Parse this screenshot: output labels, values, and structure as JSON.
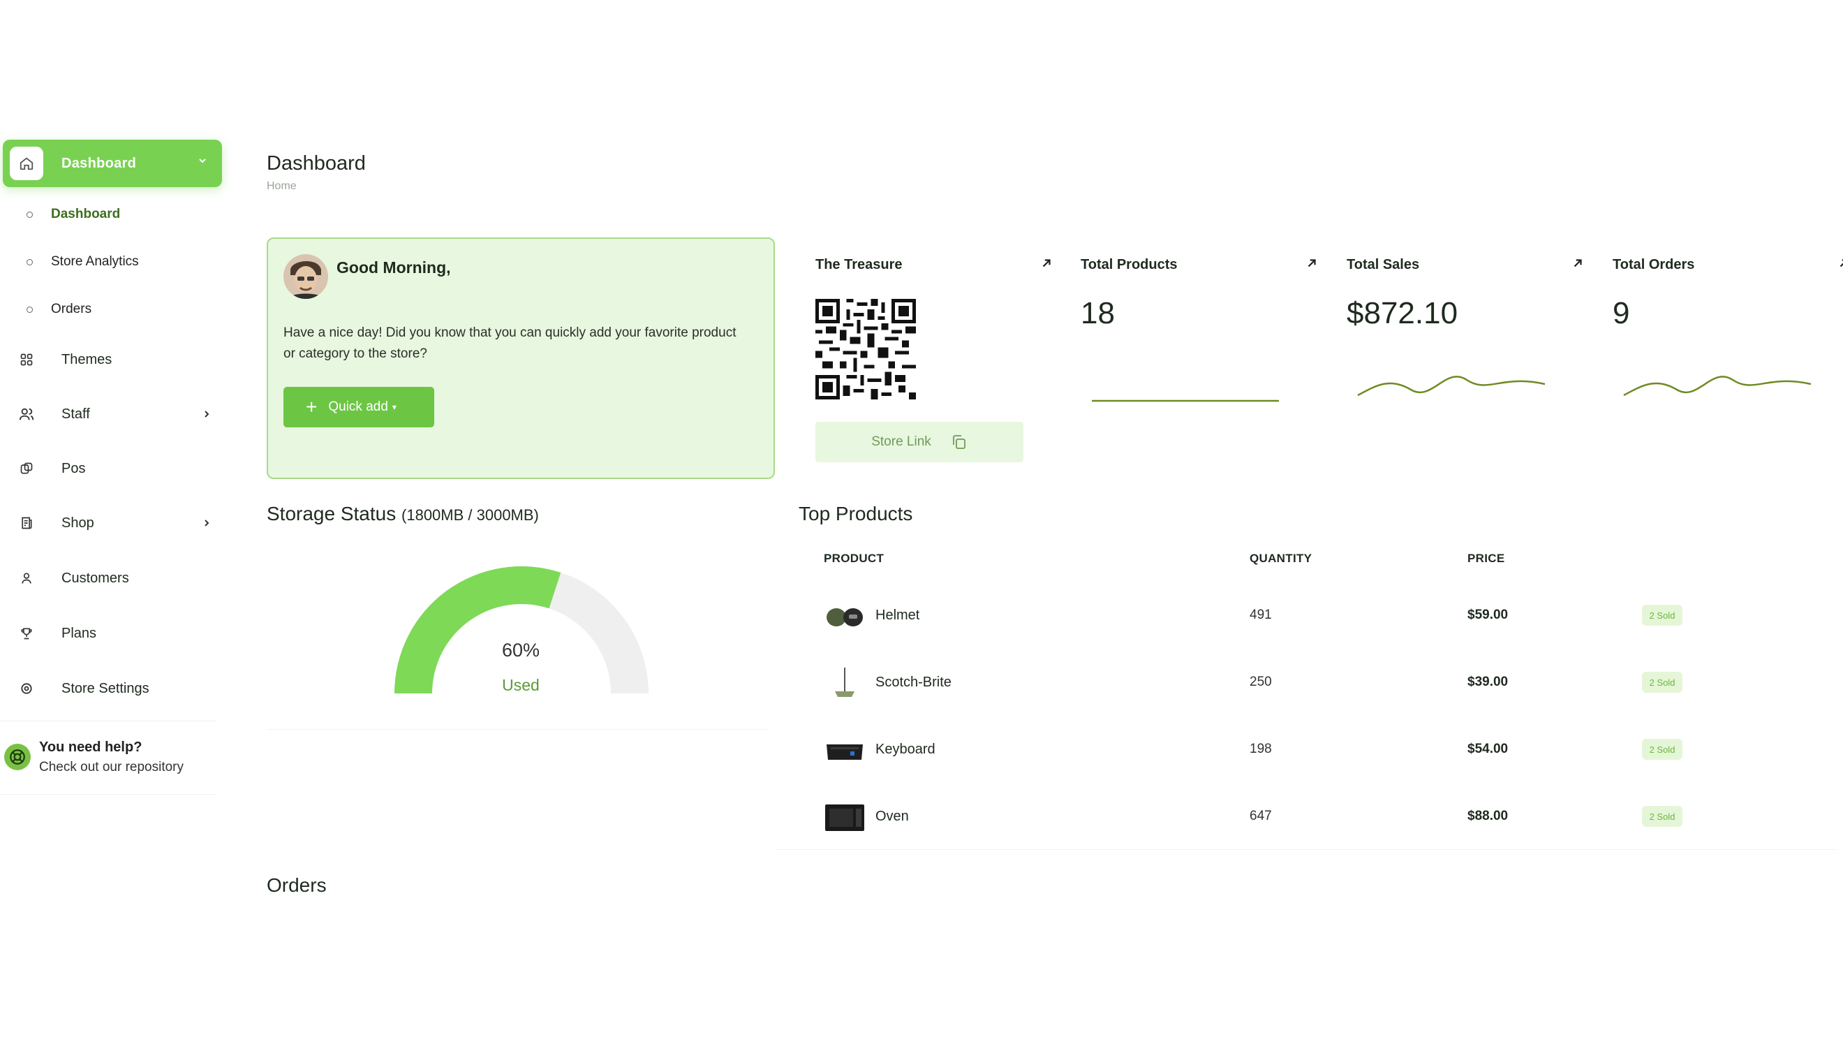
{
  "sidebar": {
    "active": {
      "label": "Dashboard"
    },
    "sub_items": [
      {
        "label": "Dashboard",
        "active": true
      },
      {
        "label": "Store Analytics"
      },
      {
        "label": "Orders"
      }
    ],
    "items": [
      {
        "label": "Themes",
        "icon": "grid-icon"
      },
      {
        "label": "Staff",
        "icon": "users-icon",
        "has_children": true
      },
      {
        "label": "Pos",
        "icon": "pos-icon"
      },
      {
        "label": "Shop",
        "icon": "shop-icon",
        "has_children": true
      },
      {
        "label": "Customers",
        "icon": "user-icon"
      },
      {
        "label": "Plans",
        "icon": "trophy-icon"
      },
      {
        "label": "Store Settings",
        "icon": "settings-icon"
      }
    ],
    "help": {
      "title": "You need help?",
      "subtitle": "Check out our repository"
    }
  },
  "header": {
    "title": "Dashboard",
    "breadcrumb": "Home"
  },
  "welcome": {
    "greeting": "Good Morning,",
    "message": "Have a nice day! Did you know that you can quickly add your favorite product or category to the store?",
    "quick_add_label": "Quick add"
  },
  "stats": [
    {
      "title": "The Treasure",
      "store_link_label": "Store Link"
    },
    {
      "title": "Total Products",
      "value": "18"
    },
    {
      "title": "Total Sales",
      "value": "$872.10"
    },
    {
      "title": "Total Orders",
      "value": "9"
    }
  ],
  "storage": {
    "title": "Storage Status",
    "detail": "(1800MB / 3000MB)",
    "percent_label": "60%",
    "used_label": "Used",
    "used_fraction": 0.6
  },
  "top_products": {
    "title": "Top Products",
    "columns": [
      "PRODUCT",
      "QUANTITY",
      "PRICE"
    ],
    "rows": [
      {
        "name": "Helmet",
        "quantity": "491",
        "price": "$59.00",
        "sold": "2 Sold"
      },
      {
        "name": "Scotch-Brite",
        "quantity": "250",
        "price": "$39.00",
        "sold": "2 Sold"
      },
      {
        "name": "Keyboard",
        "quantity": "198",
        "price": "$54.00",
        "sold": "2 Sold"
      },
      {
        "name": "Oven",
        "quantity": "647",
        "price": "$88.00",
        "sold": "2 Sold"
      }
    ]
  },
  "orders": {
    "title": "Orders"
  },
  "colors": {
    "accent": "#79d152",
    "accent_light": "#e8f7df",
    "sparkline": "#6f8a22"
  }
}
